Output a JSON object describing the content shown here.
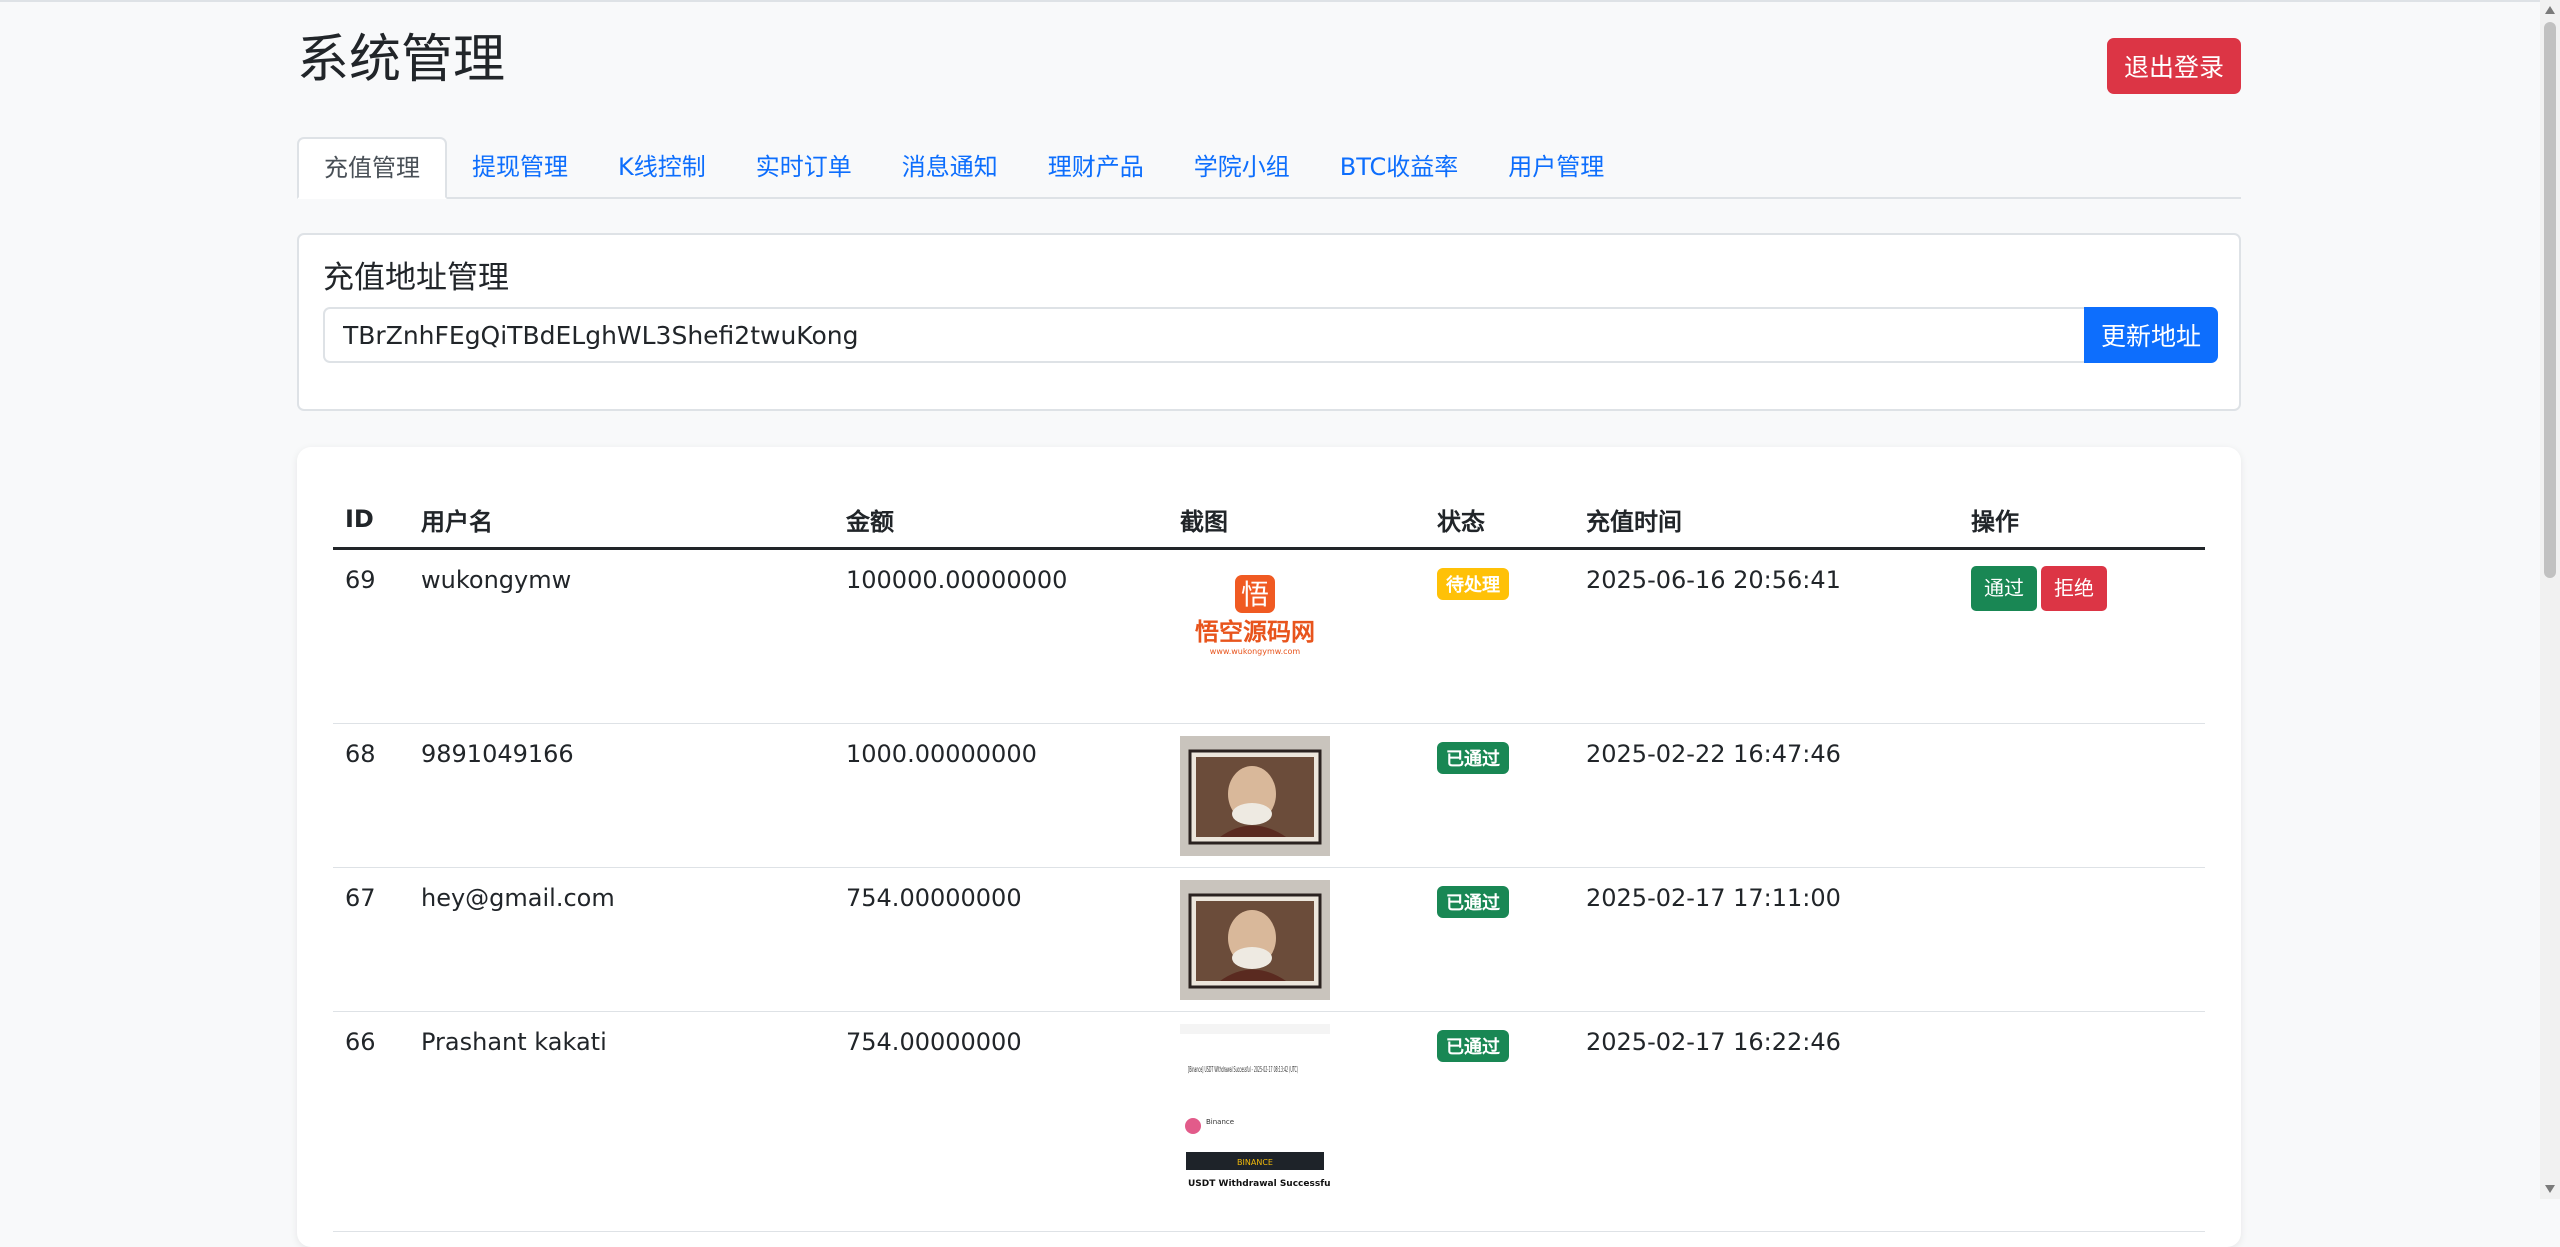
{
  "header": {
    "title": "系统管理",
    "logout_label": "退出登录"
  },
  "tabs": [
    {
      "label": "充值管理",
      "active": true
    },
    {
      "label": "提现管理",
      "active": false
    },
    {
      "label": "K线控制",
      "active": false
    },
    {
      "label": "实时订单",
      "active": false
    },
    {
      "label": "消息通知",
      "active": false
    },
    {
      "label": "理财产品",
      "active": false
    },
    {
      "label": "学院小组",
      "active": false
    },
    {
      "label": "BTC收益率",
      "active": false
    },
    {
      "label": "用户管理",
      "active": false
    }
  ],
  "address": {
    "title": "充值地址管理",
    "value": "TBrZnhFEgQiTBdELghWL3Shefi2twuKong",
    "button_label": "更新地址"
  },
  "table": {
    "columns": [
      "ID",
      "用户名",
      "金额",
      "截图",
      "状态",
      "充值时间",
      "操作"
    ],
    "rows": [
      {
        "id": "69",
        "username": "wukongymw",
        "amount": "100000.00000000",
        "screenshot": "logo",
        "status": "待处理",
        "time": "2025-06-16 20:56:41",
        "actions": [
          "通过",
          "拒绝"
        ]
      },
      {
        "id": "68",
        "username": "9891049166",
        "amount": "1000.00000000",
        "screenshot": "portrait",
        "status": "已通过",
        "time": "2025-02-22 16:47:46",
        "actions": []
      },
      {
        "id": "67",
        "username": "hey@gmail.com",
        "amount": "754.00000000",
        "screenshot": "portrait",
        "status": "已通过",
        "time": "2025-02-17 17:11:00",
        "actions": []
      },
      {
        "id": "66",
        "username": "Prashant kakati",
        "amount": "754.00000000",
        "screenshot": "receipt",
        "status": "已通过",
        "time": "2025-02-17 16:22:46",
        "actions": []
      }
    ]
  },
  "screenshot_text": {
    "logo_char": "悟",
    "logo_name": "悟空源码网",
    "logo_url": "www.wukongymw.com",
    "receipt_title": "[Binance] USDT Withdrawal Successful - 2025-02-17 08:13:42 (UTC)",
    "receipt_sender": "Binance",
    "receipt_brand": "BINANCE",
    "receipt_heading": "USDT Withdrawal Successful"
  },
  "colors": {
    "primary": "#0d6efd",
    "danger": "#dc3545",
    "success": "#198754",
    "warning": "#ffc107"
  },
  "icons": {
    "scroll_up": "triangle-up-icon",
    "scroll_down": "triangle-down-icon"
  }
}
